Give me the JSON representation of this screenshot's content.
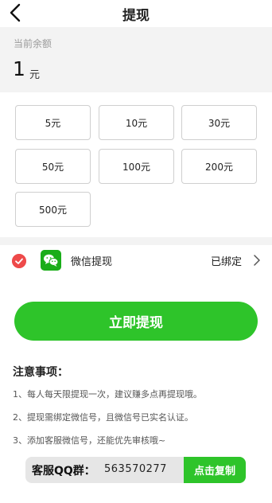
{
  "header": {
    "title": "提现"
  },
  "balance": {
    "label": "当前余额",
    "amount": "1",
    "unit": "元"
  },
  "amounts": [
    "5元",
    "10元",
    "30元",
    "50元",
    "100元",
    "200元",
    "500元"
  ],
  "payment": {
    "label": "微信提现",
    "status": "已绑定",
    "icon": "wechat-icon",
    "checked": true
  },
  "withdraw_button": {
    "label": "立即提现"
  },
  "notice": {
    "title": "注意事项：",
    "items": [
      "1、每人每天限提现一次，建议赚多点再提现哦。",
      "2、提现需绑定微信号，且微信号已实名认证。",
      "3、添加客服微信号，还能优先审核哦~"
    ]
  },
  "support": {
    "label": "客服QQ群：",
    "value": "563570277",
    "copy_label": "点击复制"
  },
  "colors": {
    "accent": "#2ec42a",
    "check": "#ee4a4a",
    "wechat": "#1aad19",
    "panel": "#f3f3f3"
  }
}
